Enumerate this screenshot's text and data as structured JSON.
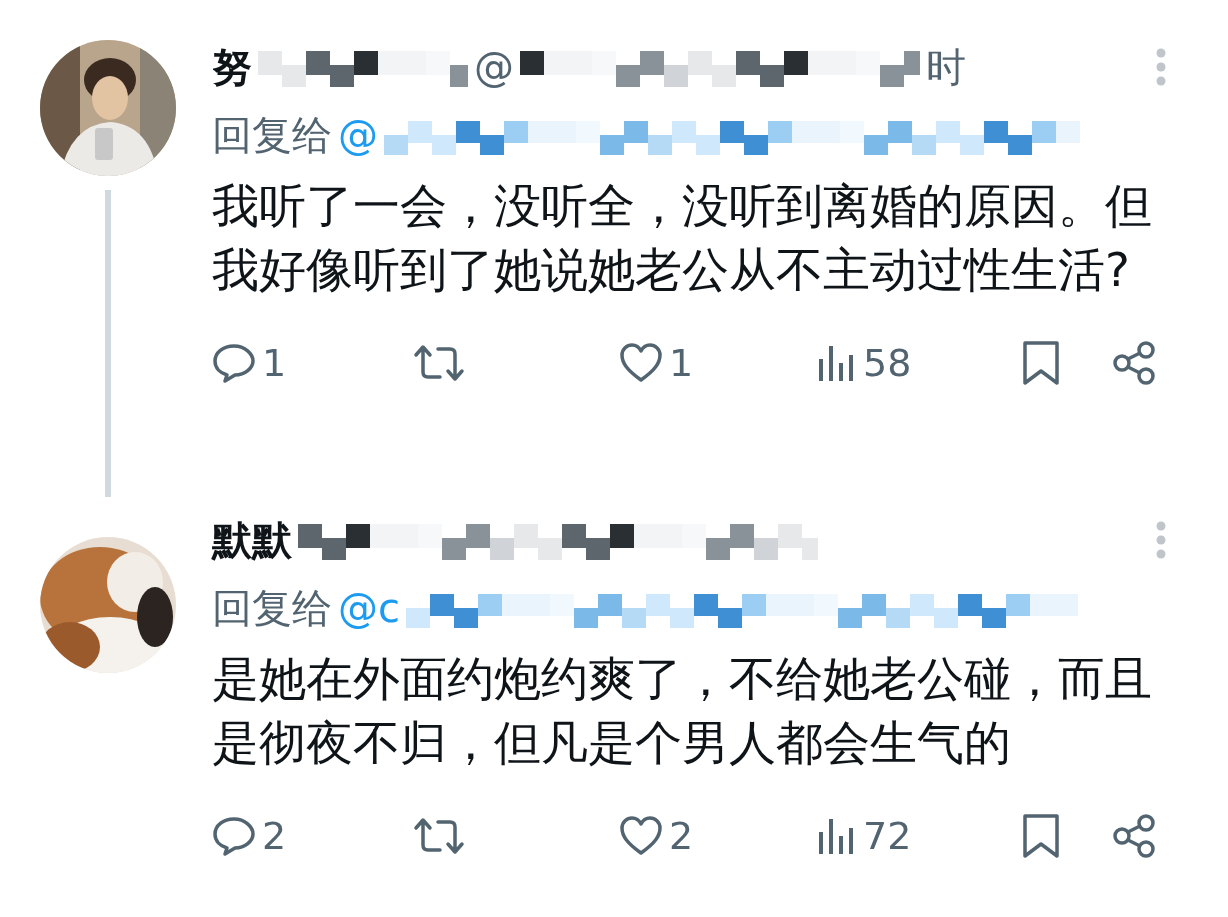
{
  "tweets": [
    {
      "name": "努",
      "handle": "@",
      "time": "时",
      "reply_label": "回复给",
      "reply_to": "@",
      "avatar": {
        "kind": "picture"
      },
      "body": [
        "我听了一会，没听全，没听到离婚的原因。但我好像听到了她说她老公从不主动过性生活?"
      ],
      "actions": [
        {
          "kind": "reply",
          "count": "1"
        },
        {
          "kind": "repost"
        },
        {
          "kind": "like",
          "count": "1"
        },
        {
          "kind": "views",
          "count": "58"
        },
        {
          "kind": "bookmark"
        },
        {
          "kind": "share"
        }
      ]
    },
    {
      "name": "默默",
      "reply_label": "回复给",
      "reply_to": "@c",
      "avatar": {
        "kind": "picture"
      },
      "body": [
        "是她在外面约炮约爽了，不给她老公碰，而且是彻夜不归，但凡是个男人都会生气的"
      ],
      "actions": [
        {
          "kind": "reply",
          "count": "2"
        },
        {
          "kind": "repost"
        },
        {
          "kind": "like",
          "count": "2"
        },
        {
          "kind": "views",
          "count": "72"
        },
        {
          "kind": "bookmark"
        },
        {
          "kind": "share"
        }
      ]
    }
  ]
}
